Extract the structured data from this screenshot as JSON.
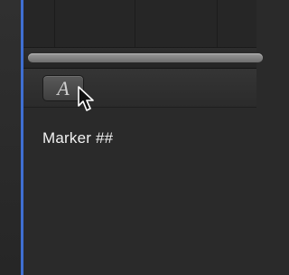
{
  "toolbar": {
    "text_tool": {
      "glyph": "A",
      "icon": "text-tool-icon"
    }
  },
  "inspector": {
    "marker_text": "Marker ##"
  },
  "colors": {
    "playhead": "#3f6fd2",
    "background": "#2a2a2a",
    "text": "#f2f2f2"
  }
}
